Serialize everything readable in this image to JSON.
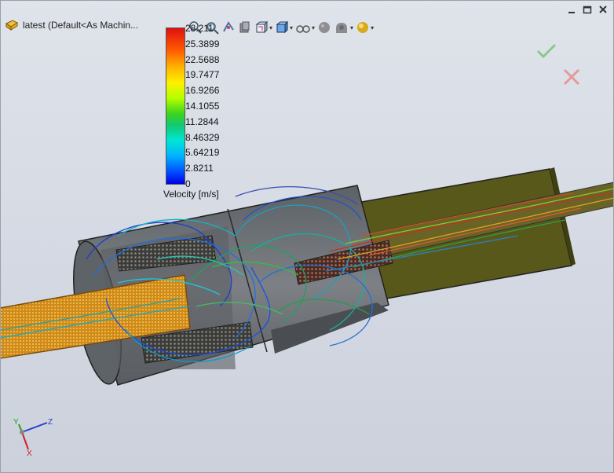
{
  "window": {
    "title": "latest  (Default<As Machin...",
    "controls": [
      "minimize",
      "maximize",
      "close"
    ]
  },
  "toolbar": {
    "buttons": [
      {
        "icon": "zoom-to-fit-icon"
      },
      {
        "icon": "zoom-to-area-icon"
      },
      {
        "icon": "previous-view-icon"
      },
      {
        "icon": "section-view-icon"
      },
      {
        "icon": "view-orientation-icon",
        "dropdown": true
      },
      {
        "icon": "display-style-icon",
        "dropdown": true
      },
      {
        "icon": "hide-show-items-icon",
        "dropdown": true
      },
      {
        "icon": "edit-appearance-icon"
      },
      {
        "icon": "apply-scene-icon",
        "dropdown": true
      },
      {
        "icon": "view-settings-icon",
        "dropdown": true
      }
    ]
  },
  "legend": {
    "ticks": [
      "28.211",
      "25.3899",
      "22.5688",
      "19.7477",
      "16.9266",
      "14.1055",
      "11.2844",
      "8.46329",
      "5.64219",
      "2.8211",
      "0"
    ],
    "title": "Velocity [m/s]",
    "min": 0,
    "max": 28.211
  },
  "confirm_corner": {
    "ok_icon": "checkmark-icon",
    "cancel_icon": "cancel-x-icon"
  },
  "triad": {
    "axes": [
      "Z",
      "Y",
      "X"
    ]
  },
  "colors": {
    "background": "#d4d9e3",
    "body_shell": "#6b6f72",
    "outlet_shroud": "#5a5a18",
    "inlet_mesh": "#d09020",
    "ok": "#8ac98a",
    "cancel": "#e39a9a"
  }
}
